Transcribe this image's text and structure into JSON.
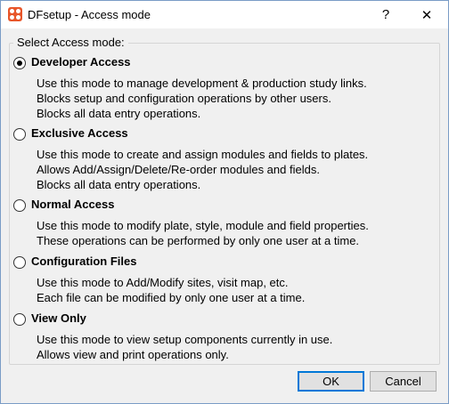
{
  "window": {
    "title": "DFsetup - Access mode",
    "help_label": "?",
    "close_label": "✕"
  },
  "group_label": "Select Access mode:",
  "options": [
    {
      "label": "Developer Access",
      "checked": true,
      "lines": [
        "Use this mode to manage development & production study links.",
        "Blocks setup and configuration operations by other users.",
        "Blocks all data entry operations."
      ]
    },
    {
      "label": "Exclusive Access",
      "checked": false,
      "lines": [
        "Use this mode to create and assign modules and fields to plates.",
        "Allows Add/Assign/Delete/Re-order modules and fields.",
        "Blocks all data entry operations."
      ]
    },
    {
      "label": "Normal Access",
      "checked": false,
      "lines": [
        "Use this mode to modify plate, style, module and field properties.",
        "These operations can be performed by only one user at a time."
      ]
    },
    {
      "label": "Configuration Files",
      "checked": false,
      "lines": [
        "Use this mode to Add/Modify sites, visit map, etc.",
        "Each file can be modified by only one user at a time."
      ]
    },
    {
      "label": "View Only",
      "checked": false,
      "lines": [
        "Use this mode to view setup components currently in use.",
        "Allows view and print operations only."
      ]
    }
  ],
  "buttons": {
    "ok_label": "OK",
    "cancel_label": "Cancel"
  }
}
